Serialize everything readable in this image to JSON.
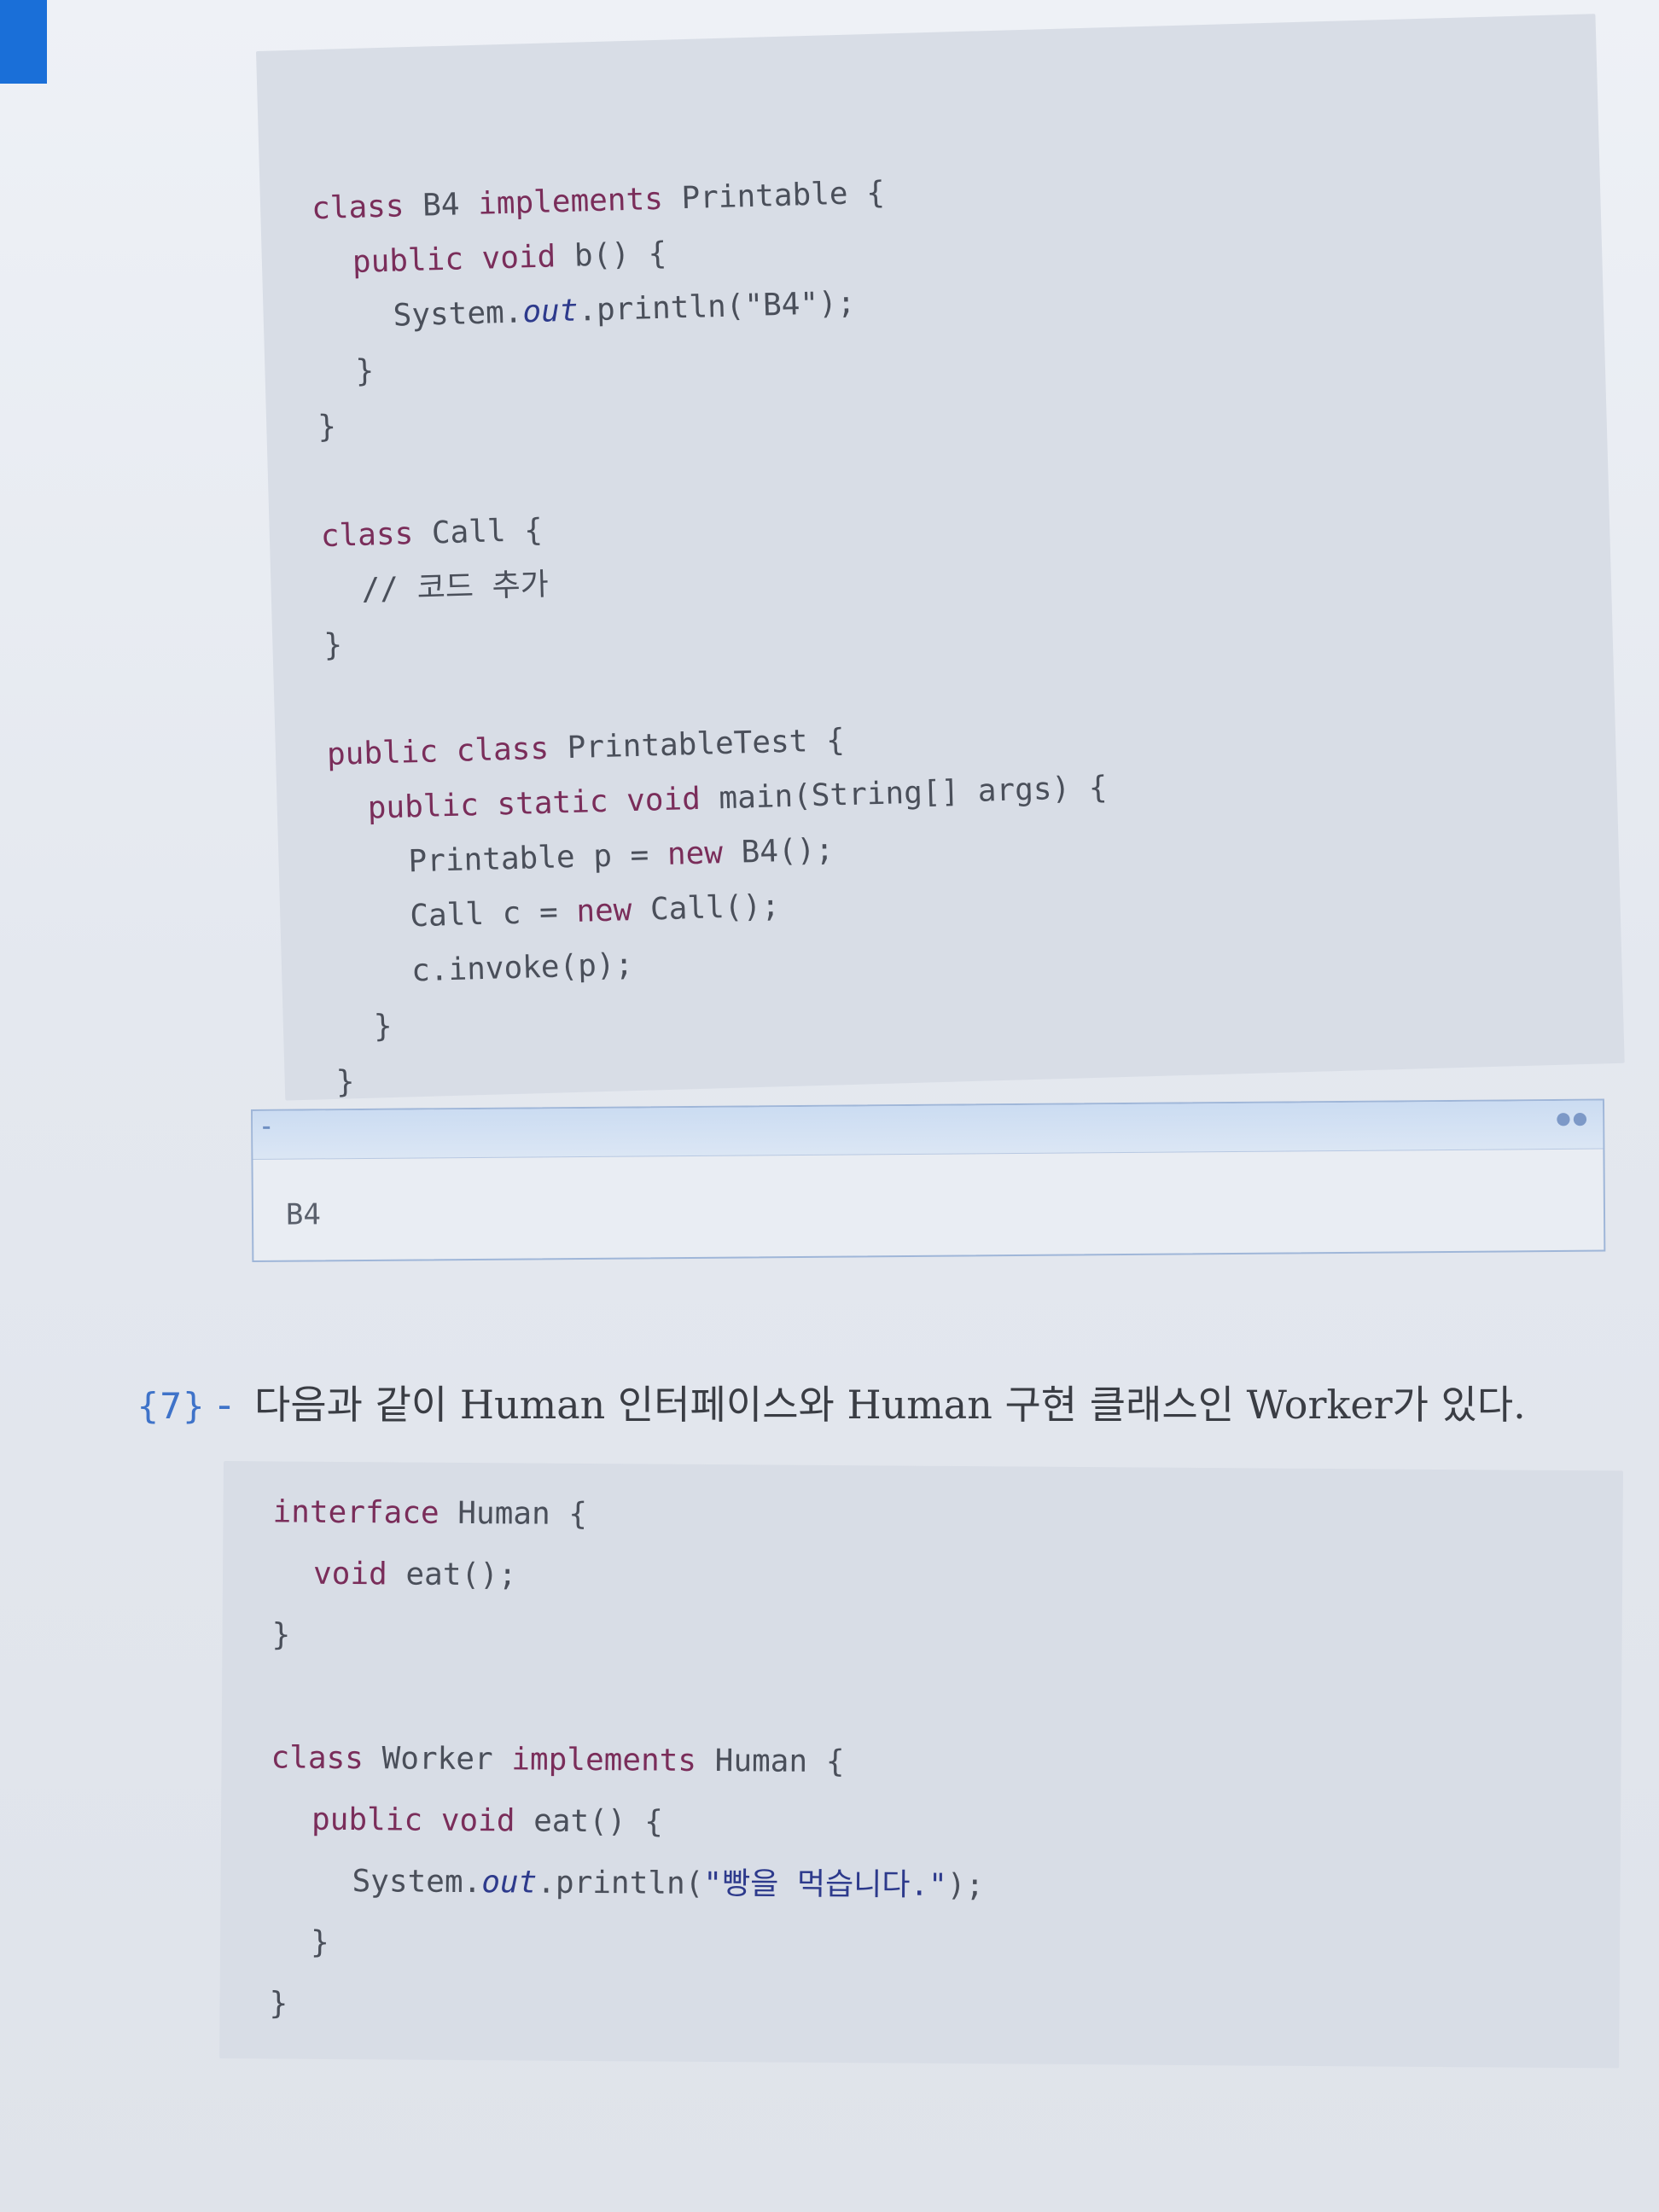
{
  "page": {
    "code_block_1": {
      "lines": [
        {
          "indent": 0,
          "tokens": [
            {
              "t": "class ",
              "c": "kw"
            },
            {
              "t": "B4 ",
              "c": ""
            },
            {
              "t": "implements ",
              "c": "kw"
            },
            {
              "t": "Printable {",
              "c": ""
            }
          ]
        },
        {
          "indent": 1,
          "tokens": [
            {
              "t": "public void ",
              "c": "kw"
            },
            {
              "t": "b() {",
              "c": ""
            }
          ]
        },
        {
          "indent": 2,
          "tokens": [
            {
              "t": "System.",
              "c": ""
            },
            {
              "t": "out",
              "c": "fld"
            },
            {
              "t": ".println(\"B4\");",
              "c": ""
            }
          ]
        },
        {
          "indent": 1,
          "tokens": [
            {
              "t": "}",
              "c": ""
            }
          ]
        },
        {
          "indent": 0,
          "tokens": [
            {
              "t": "}",
              "c": ""
            }
          ]
        },
        {
          "indent": 0,
          "tokens": []
        },
        {
          "indent": 0,
          "tokens": [
            {
              "t": "class ",
              "c": "kw"
            },
            {
              "t": "Call {",
              "c": ""
            }
          ]
        },
        {
          "indent": 1,
          "tokens": [
            {
              "t": "// 코드 추가",
              "c": ""
            }
          ]
        },
        {
          "indent": 0,
          "tokens": [
            {
              "t": "}",
              "c": ""
            }
          ]
        },
        {
          "indent": 0,
          "tokens": []
        },
        {
          "indent": 0,
          "tokens": [
            {
              "t": "public class ",
              "c": "kw"
            },
            {
              "t": "PrintableTest {",
              "c": ""
            }
          ]
        },
        {
          "indent": 1,
          "tokens": [
            {
              "t": "public static void ",
              "c": "kw"
            },
            {
              "t": "main(String[] args) {",
              "c": ""
            }
          ]
        },
        {
          "indent": 2,
          "tokens": [
            {
              "t": "Printable p = ",
              "c": ""
            },
            {
              "t": "new ",
              "c": "kw"
            },
            {
              "t": "B4();",
              "c": ""
            }
          ]
        },
        {
          "indent": 2,
          "tokens": [
            {
              "t": "Call c = ",
              "c": ""
            },
            {
              "t": "new ",
              "c": "kw"
            },
            {
              "t": "Call();",
              "c": ""
            }
          ]
        },
        {
          "indent": 2,
          "tokens": [
            {
              "t": "c.invoke(p);",
              "c": ""
            }
          ]
        },
        {
          "indent": 1,
          "tokens": [
            {
              "t": "}",
              "c": ""
            }
          ]
        },
        {
          "indent": 0,
          "tokens": [
            {
              "t": "}",
              "c": ""
            }
          ]
        }
      ]
    },
    "output": {
      "text": "B4"
    },
    "question": {
      "number": "{7}",
      "dash": "-",
      "text": "다음과 같이 Human 인터페이스와 Human 구현 클래스인 Worker가 있다."
    },
    "code_block_2": {
      "lines": [
        {
          "indent": 0,
          "tokens": [
            {
              "t": "interface ",
              "c": "kw"
            },
            {
              "t": "Human {",
              "c": ""
            }
          ]
        },
        {
          "indent": 1,
          "tokens": [
            {
              "t": "void ",
              "c": "kw"
            },
            {
              "t": "eat();",
              "c": ""
            }
          ]
        },
        {
          "indent": 0,
          "tokens": [
            {
              "t": "}",
              "c": ""
            }
          ]
        },
        {
          "indent": 0,
          "tokens": []
        },
        {
          "indent": 0,
          "tokens": [
            {
              "t": "class ",
              "c": "kw"
            },
            {
              "t": "Worker ",
              "c": ""
            },
            {
              "t": "implements ",
              "c": "kw"
            },
            {
              "t": "Human {",
              "c": ""
            }
          ]
        },
        {
          "indent": 1,
          "tokens": [
            {
              "t": "public void ",
              "c": "kw"
            },
            {
              "t": "eat() {",
              "c": ""
            }
          ]
        },
        {
          "indent": 2,
          "tokens": [
            {
              "t": "System.",
              "c": ""
            },
            {
              "t": "out",
              "c": "fld"
            },
            {
              "t": ".println(",
              "c": ""
            },
            {
              "t": "\"빵을 먹습니다.\"",
              "c": "str"
            },
            {
              "t": ");",
              "c": ""
            }
          ]
        },
        {
          "indent": 1,
          "tokens": [
            {
              "t": "}",
              "c": ""
            }
          ]
        },
        {
          "indent": 0,
          "tokens": [
            {
              "t": "}",
              "c": ""
            }
          ]
        }
      ]
    }
  }
}
